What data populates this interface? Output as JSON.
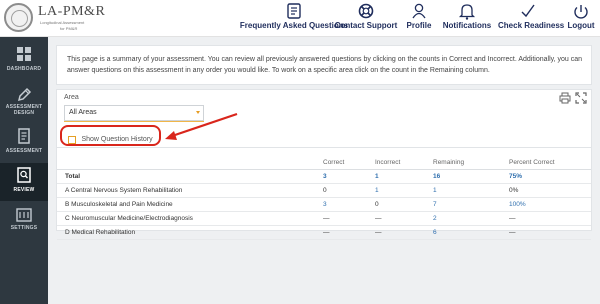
{
  "app": {
    "logo_title": "LA-PM&R",
    "logo_sub1": "Longitudinal Assessment",
    "logo_sub2": "for PM&R"
  },
  "nav": [
    {
      "label": "Frequently Asked Questions",
      "icon": "faq-icon"
    },
    {
      "label": "Contact Support",
      "icon": "lifebuoy-icon"
    },
    {
      "label": "Profile",
      "icon": "user-icon"
    },
    {
      "label": "Notifications",
      "icon": "bell-icon"
    },
    {
      "label": "Check Readiness",
      "icon": "checkmark-icon"
    },
    {
      "label": "Logout",
      "icon": "power-icon"
    }
  ],
  "sidebar": [
    {
      "label": "DASHBOARD",
      "icon": "dashboard-icon"
    },
    {
      "label": "ASSESSMENT DESIGN",
      "icon": "pencil-icon"
    },
    {
      "label": "ASSESSMENT",
      "icon": "document-icon"
    },
    {
      "label": "REVIEW",
      "icon": "review-icon",
      "active": true
    },
    {
      "label": "SETTINGS",
      "icon": "settings-icon"
    }
  ],
  "info_text": "This page is a summary of your assessment. You can review all previously answered questions by clicking on the counts in Correct and Incorrect. Additionally, you can answer questions on this assessment in any order you would like. To work on a specific area click on the count in the Remaining column.",
  "filter": {
    "area_label": "Area",
    "area_value": "All Areas",
    "show_history_label": "Show Question History",
    "show_history_checked": false
  },
  "table": {
    "headers": [
      "",
      "Correct",
      "Incorrect",
      "Remaining",
      "Percent Correct"
    ],
    "rows": [
      {
        "name": "Total",
        "correct": "3",
        "incorrect": "1",
        "remaining": "16",
        "percent": "75%"
      },
      {
        "name": "A Central Nervous System Rehabilitation",
        "correct": "0",
        "incorrect": "1",
        "remaining": "1",
        "percent": "0%"
      },
      {
        "name": "B Musculoskeletal and Pain Medicine",
        "correct": "3",
        "incorrect": "0",
        "remaining": "7",
        "percent": "100%"
      },
      {
        "name": "C Neuromuscular Medicine/Electrodiagnosis",
        "correct": "—",
        "incorrect": "—",
        "remaining": "2",
        "percent": "—"
      },
      {
        "name": "D Medical Rehabilitation",
        "correct": "—",
        "incorrect": "—",
        "remaining": "6",
        "percent": "—"
      }
    ]
  },
  "colors": {
    "sidebar_bg": "#2e3840",
    "nav_text": "#1f2d5c",
    "link": "#2f6fae",
    "highlight_red": "#d9261c",
    "accent_orange": "#e5a026"
  }
}
